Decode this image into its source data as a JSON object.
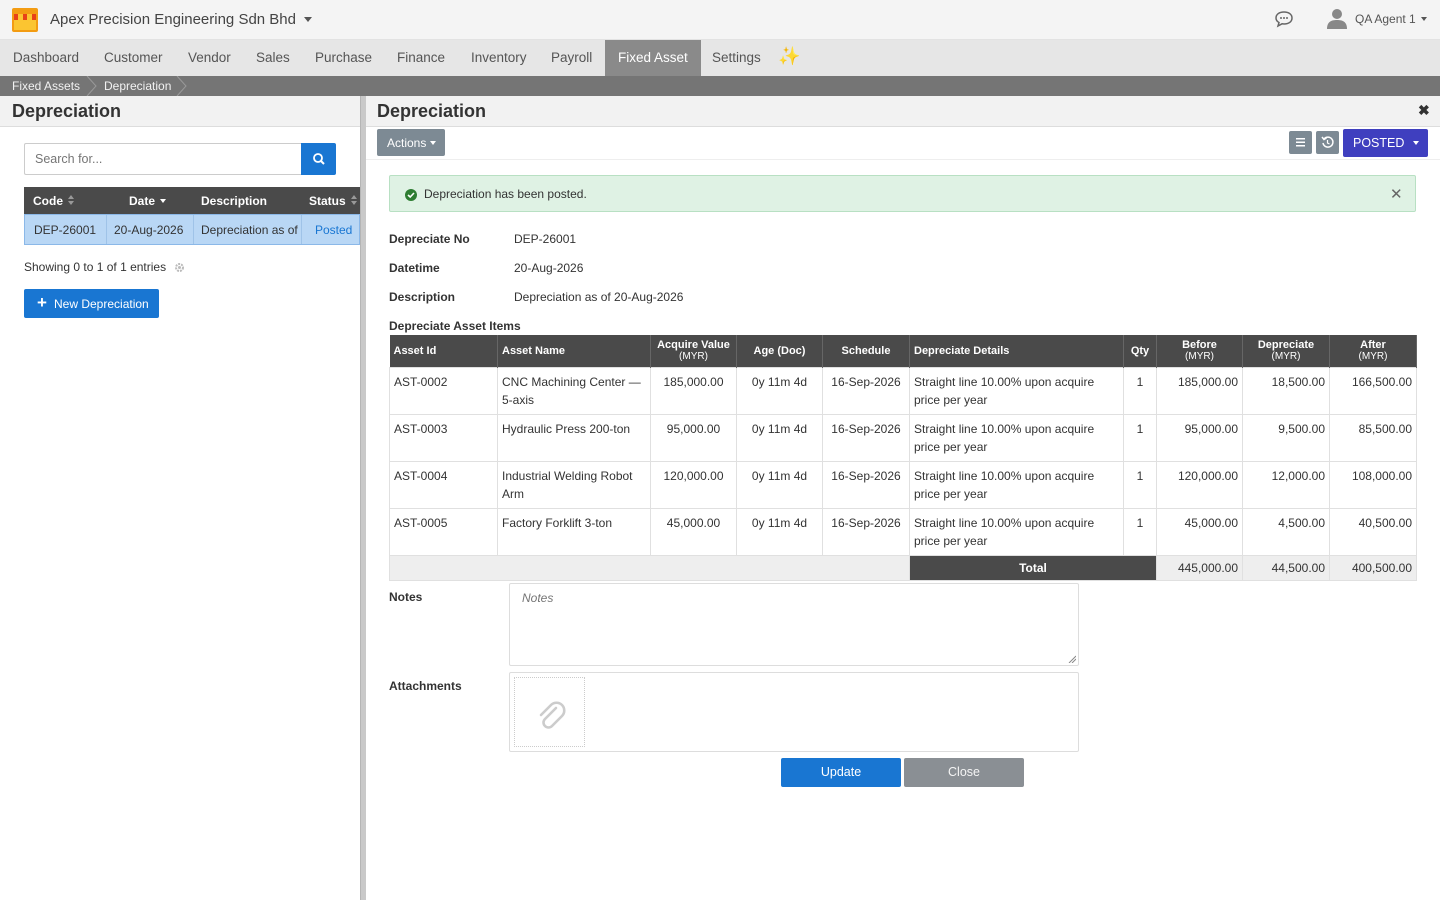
{
  "app": {
    "company_name": "Apex Precision Engineering Sdn Bhd",
    "user_name": "QA Agent 1"
  },
  "nav": {
    "items": [
      "Dashboard",
      "Customer",
      "Vendor",
      "Sales",
      "Purchase",
      "Finance",
      "Inventory",
      "Payroll",
      "Fixed Asset",
      "Settings"
    ],
    "active": "Fixed Asset"
  },
  "breadcrumb": [
    "Fixed Assets",
    "Depreciation"
  ],
  "left": {
    "title": "Depreciation",
    "search_placeholder": "Search for...",
    "columns": [
      "Code",
      "Date",
      "Description",
      "Status"
    ],
    "rows": [
      {
        "code": "DEP-26001",
        "date": "20-Aug-2026",
        "description": "Depreciation as of",
        "status": "Posted"
      }
    ],
    "showing": "Showing 0 to 1 of 1 entries",
    "new_button": "New Depreciation"
  },
  "detail": {
    "title": "Depreciation",
    "actions_label": "Actions",
    "status_button": "POSTED",
    "alert": "Depreciation has been posted.",
    "fields": {
      "depreciate_no_label": "Depreciate No",
      "depreciate_no": "DEP-26001",
      "datetime_label": "Datetime",
      "datetime": "20-Aug-2026",
      "description_label": "Description",
      "description": "Depreciation as of 20-Aug-2026"
    },
    "items_title": "Depreciate Asset Items",
    "columns": {
      "asset_id": "Asset Id",
      "asset_name": "Asset Name",
      "acquire_value": "Acquire Value",
      "age": "Age (Doc)",
      "schedule": "Schedule",
      "details": "Depreciate Details",
      "qty": "Qty",
      "before": "Before",
      "depreciate": "Depreciate",
      "after": "After",
      "currency": "(MYR)"
    },
    "items": [
      {
        "asset_id": "AST-0002",
        "asset_name": "CNC Machining Center — 5-axis",
        "acquire_value": "185,000.00",
        "age": "0y 11m 4d",
        "schedule": "16-Sep-2026",
        "details": "Straight line 10.00% upon acquire price per year",
        "qty": "1",
        "before": "185,000.00",
        "depreciate": "18,500.00",
        "after": "166,500.00"
      },
      {
        "asset_id": "AST-0003",
        "asset_name": "Hydraulic Press 200-ton",
        "acquire_value": "95,000.00",
        "age": "0y 11m 4d",
        "schedule": "16-Sep-2026",
        "details": "Straight line 10.00% upon acquire price per year",
        "qty": "1",
        "before": "95,000.00",
        "depreciate": "9,500.00",
        "after": "85,500.00"
      },
      {
        "asset_id": "AST-0004",
        "asset_name": "Industrial Welding Robot Arm",
        "acquire_value": "120,000.00",
        "age": "0y 11m 4d",
        "schedule": "16-Sep-2026",
        "details": "Straight line 10.00% upon acquire price per year",
        "qty": "1",
        "before": "120,000.00",
        "depreciate": "12,000.00",
        "after": "108,000.00"
      },
      {
        "asset_id": "AST-0005",
        "asset_name": "Factory Forklift 3-ton",
        "acquire_value": "45,000.00",
        "age": "0y 11m 4d",
        "schedule": "16-Sep-2026",
        "details": "Straight line 10.00% upon acquire price per year",
        "qty": "1",
        "before": "45,000.00",
        "depreciate": "4,500.00",
        "after": "40,500.00"
      }
    ],
    "total": {
      "label": "Total",
      "before": "445,000.00",
      "depreciate": "44,500.00",
      "after": "400,500.00"
    },
    "notes_label": "Notes",
    "notes_placeholder": "Notes",
    "attachments_label": "Attachments",
    "update_button": "Update",
    "close_button": "Close"
  },
  "colors": {
    "primary": "#1976d2",
    "posted": "#3f3fbf",
    "success_bg": "#dff2e4",
    "header_dark": "#4a4a4a"
  }
}
